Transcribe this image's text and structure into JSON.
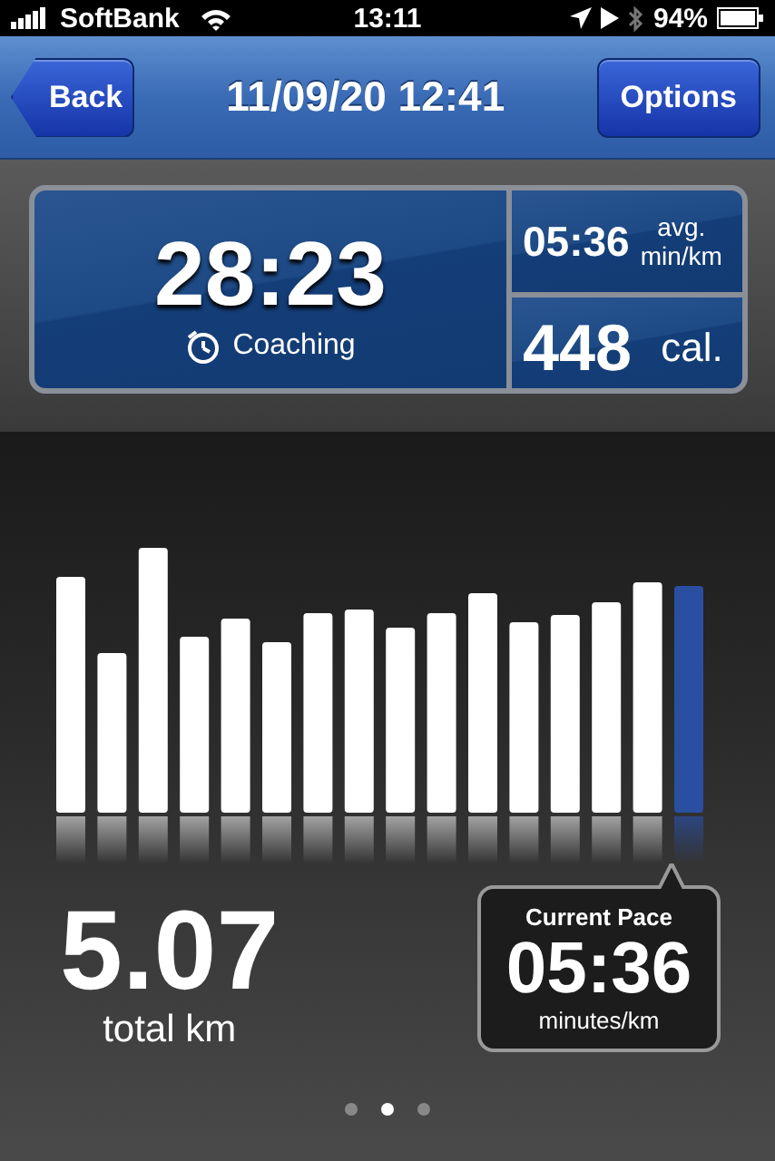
{
  "status_bar": {
    "carrier": "SoftBank",
    "time": "13:11",
    "battery": "94%"
  },
  "nav_bar": {
    "back": "Back",
    "title": "11/09/20 12:41",
    "options": "Options"
  },
  "stats": {
    "duration": "28:23",
    "coaching": "Coaching",
    "avg_pace": "05:36",
    "avg_pace_unit_1": "avg.",
    "avg_pace_unit_2": "min/km",
    "calories": "448",
    "calories_unit": "cal."
  },
  "distance": {
    "value": "5.07",
    "label": "total km"
  },
  "current_pace": {
    "title": "Current Pace",
    "value": "05:36",
    "unit": "minutes/km"
  },
  "page_dots": [
    {
      "selected": false
    },
    {
      "selected": true
    },
    {
      "selected": false
    }
  ]
}
